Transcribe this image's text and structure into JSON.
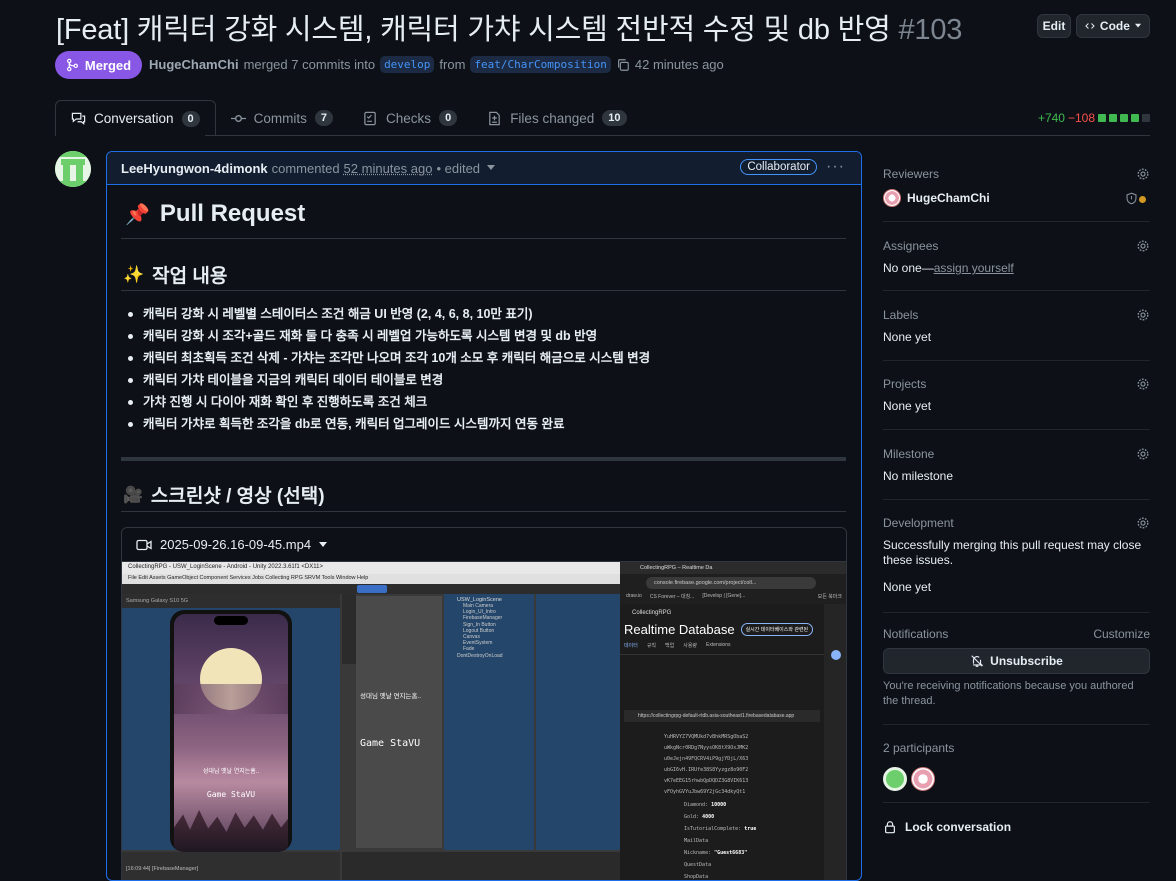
{
  "header": {
    "title": "[Feat] 캐릭터 강화 시스템, 캐릭터 가챠 시스템 전반적 수정 및 db 반영",
    "number": "#103",
    "edit_label": "Edit",
    "code_label": "Code"
  },
  "status": {
    "badge": "Merged",
    "author": "HugeChamChi",
    "merged_text": "merged 7 commits into",
    "base_branch": "develop",
    "from_text": "from",
    "head_branch": "feat/CharComposition",
    "time": "42 minutes ago"
  },
  "tabs": [
    {
      "label": "Conversation",
      "count": "0"
    },
    {
      "label": "Commits",
      "count": "7"
    },
    {
      "label": "Checks",
      "count": "0"
    },
    {
      "label": "Files changed",
      "count": "10"
    }
  ],
  "diffstat": {
    "additions": "+740",
    "deletions": "−108"
  },
  "comment": {
    "author": "LeeHyungwon-4dimonk",
    "action": "commented",
    "time": "52 minutes ago",
    "edited": "• edited",
    "role": "Collaborator",
    "h1_emoji": "📌",
    "h1": "Pull Request",
    "h2_work_emoji": "✨",
    "h2_work": "작업 내용",
    "items": [
      "캐릭터 강화 시 레벨별 스테이터스 조건 해금 UI 반영 (2, 4, 6, 8, 10만 표기)",
      "캐릭터 강화 시 조각+골드 재화 둘 다 충족 시 레벨업 가능하도록 시스템 변경 및 db 반영",
      "캐릭터 최초획득 조건 삭제 - 가챠는 조각만 나오며 조각 10개 소모 후 캐릭터 해금으로 시스템 변경",
      "캐릭터 가챠 테이블을 지금의 캐릭터 데이터 테이블로 변경",
      "가챠 진행 시 다이아 재화 확인 후 진행하도록 조건 체크",
      "캐릭터 가챠로 획득한 조각을 db로 연동, 캐릭터 업그레이드 시스템까지 연동 완료"
    ],
    "h2_shot_emoji": "🎥",
    "h2_shot": "스크린샷 / 영상 (선택)",
    "video_file": "2025-09-26.16-09-45.mp4"
  },
  "video": {
    "unity_title": "CollectingRPG - USW_LoginScene - Android - Unity 2022.3.61f1 <DX11>",
    "unity_menu": "File  Edit  Assets  GameObject  Component  Services  Jobs  Collecting RPG  SRVM  Tools  Window  Help",
    "unity_device": "Samsung Galaxy S10 5G",
    "phone_text1": "성대님 옛날 연지는홈..",
    "phone_text2": "Game StaVU",
    "scene_text1": "성대님 옛날 연지는홈..",
    "scene_text2": "Game StaVU",
    "hierarchy_root": "USW_LoginScene",
    "hierarchy": [
      "Main Camera",
      "Login_UI_Intro",
      "FirebaseManager",
      "Sign_In Button",
      "Logout Button",
      "Canvas",
      "EventSystem",
      "Fade",
      "DontDestroyOnLoad"
    ],
    "console_line": "[16:09:44] [FirebaseManager]",
    "browser_tab": "CollectingRPG – Realtime Da",
    "browser_url": "console.firebase.google.com/project/coll...",
    "bookmarks": [
      "draw.io",
      "CS Forever – 대칭...",
      "[Develop | [Gene]..."
    ],
    "bookmarks_right": "모든 북마크",
    "fb_project": "CollectingRPG",
    "fb_title": "Realtime Database",
    "fb_button": "실시간 데이터베이스와 관련된",
    "fb_tabs": [
      "데이터",
      "규칙",
      "백업",
      "사용량",
      "Extensions"
    ],
    "fb_url": "https://collectingrpg-default-rtdb.asia-southeast1.firebasedatabase.app",
    "fb_keys": [
      "YuHRVYZ7VQMUkd7vBhkMRSgObaS2",
      "uWkgNcr0RDg7NyysOK8tX9OxJMK2",
      "u0eJejn49FQCRV4iP9gjYDjL/X63",
      "ubGI6vH.IRUfe38S8Yyzgz8o90F2",
      "vK7eEEG15rhwbQpDQDZ3G8VIK613",
      "vFOyhGVYuJbw69Y2jGc34dkyQt1"
    ],
    "fb_fields": [
      {
        "k": "Diamond:",
        "v": "10000"
      },
      {
        "k": "Gold:",
        "v": "4000"
      },
      {
        "k": "IsTutorialComplete:",
        "v": "true"
      },
      {
        "k": "MailData",
        "v": ""
      },
      {
        "k": "Nickname:",
        "v": "\"Guest6683\""
      },
      {
        "k": "QuestData",
        "v": ""
      },
      {
        "k": "ShopData",
        "v": ""
      }
    ]
  },
  "sidebar": {
    "reviewers_label": "Reviewers",
    "reviewer": "HugeChamChi",
    "assignees_label": "Assignees",
    "assignees_value": "No one—",
    "assign_yourself": "assign yourself",
    "labels_label": "Labels",
    "labels_value": "None yet",
    "projects_label": "Projects",
    "projects_value": "None yet",
    "milestone_label": "Milestone",
    "milestone_value": "No milestone",
    "development_label": "Development",
    "development_text": "Successfully merging this pull request may close these issues.",
    "development_value": "None yet",
    "notifications_label": "Notifications",
    "customize": "Customize",
    "unsubscribe": "Unsubscribe",
    "notif_reason": "You're receiving notifications because you authored the thread.",
    "participants": "2 participants",
    "lock": "Lock conversation"
  },
  "colors": {
    "merged": "#8957e5",
    "accent_blue": "#1f6feb",
    "add_green": "#3fb950",
    "del_red": "#f85149",
    "pending_dot": "#d29922"
  }
}
